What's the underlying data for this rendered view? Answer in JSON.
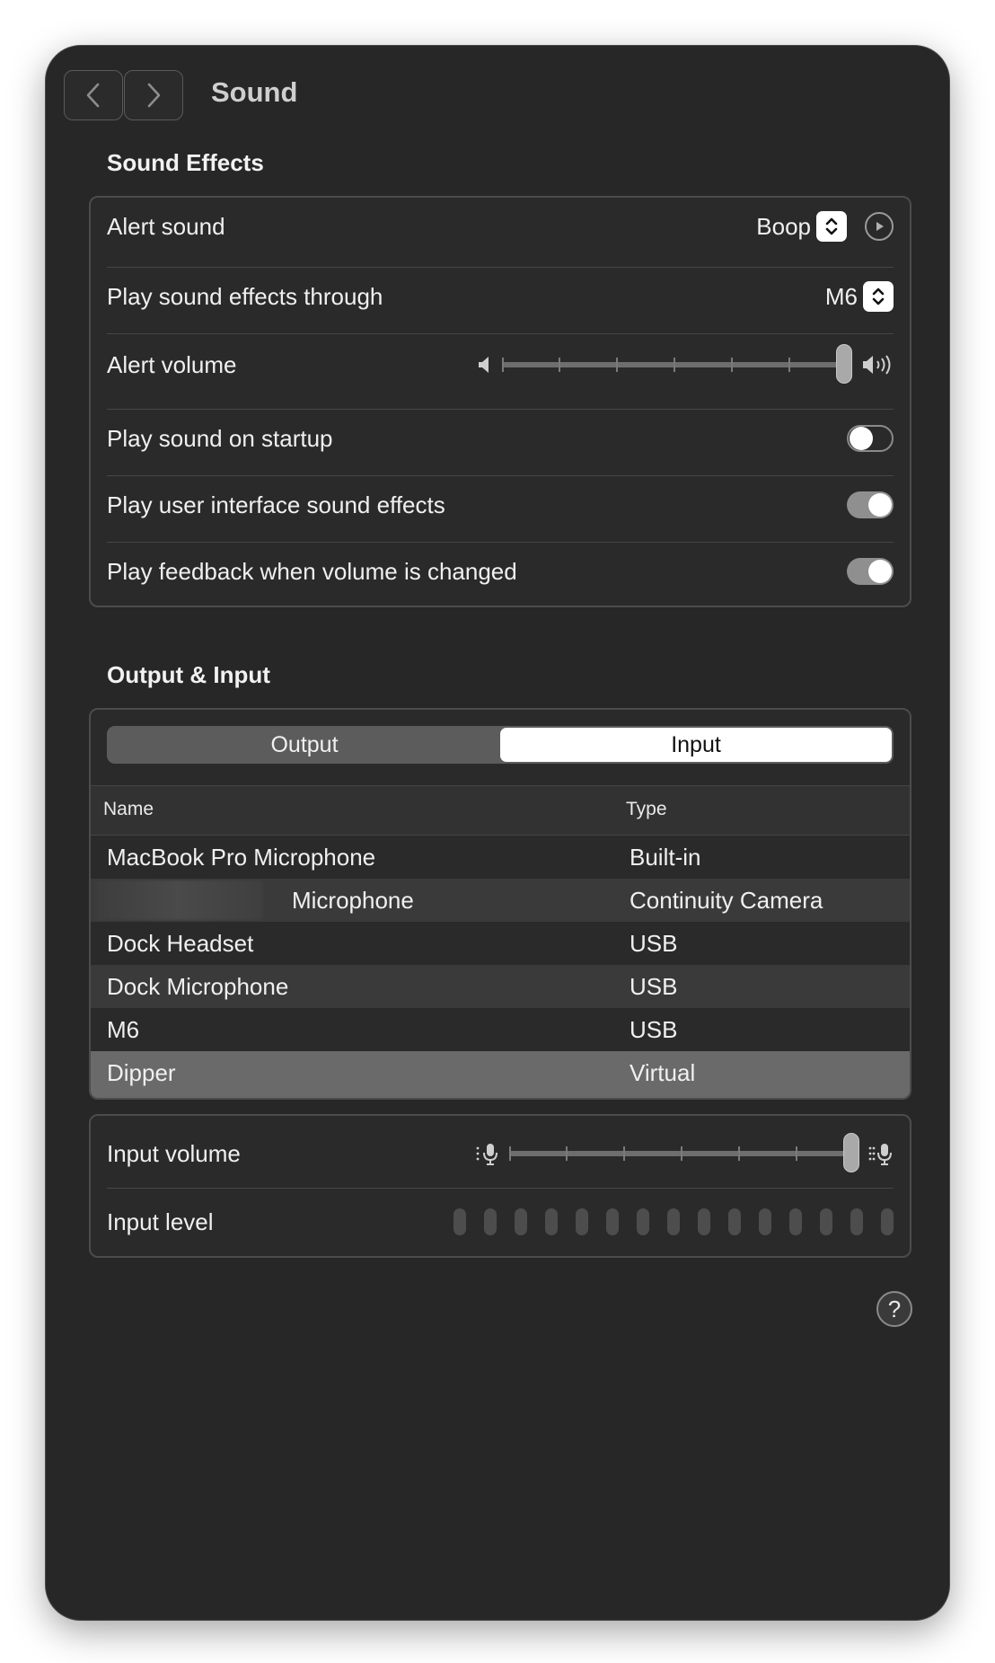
{
  "window": {
    "title": "Sound"
  },
  "nav": {
    "back_icon": "chevron-left-icon",
    "forward_icon": "chevron-right-icon"
  },
  "sound_effects": {
    "title": "Sound Effects",
    "alert_sound": {
      "label": "Alert sound",
      "value": "Boop"
    },
    "play_through": {
      "label": "Play sound effects through",
      "value": "M6"
    },
    "alert_volume": {
      "label": "Alert volume",
      "level": 1.0
    },
    "startup": {
      "label": "Play sound on startup",
      "on": false
    },
    "ui_effects": {
      "label": "Play user interface sound effects",
      "on": true
    },
    "feedback": {
      "label": "Play feedback when volume is changed",
      "on": true
    }
  },
  "output_input": {
    "title": "Output & Input",
    "tabs": [
      {
        "label": "Output",
        "active": false
      },
      {
        "label": "Input",
        "active": true
      }
    ],
    "columns": {
      "name": "Name",
      "type": "Type"
    },
    "rows": [
      {
        "name": "MacBook Pro Microphone",
        "type": "Built-in",
        "selected": false
      },
      {
        "name": "Microphone",
        "type": "Continuity Camera",
        "selected": false,
        "redacted_prefix": true
      },
      {
        "name": "Dock Headset",
        "type": "USB",
        "selected": false
      },
      {
        "name": "Dock Microphone",
        "type": "USB",
        "selected": false
      },
      {
        "name": "M6",
        "type": "USB",
        "selected": false
      },
      {
        "name": "Dipper",
        "type": "Virtual",
        "selected": true
      }
    ]
  },
  "input": {
    "volume": {
      "label": "Input volume",
      "level": 1.0
    },
    "level": {
      "label": "Input level",
      "bars": 15,
      "lit": 0
    }
  },
  "help": {
    "label": "?"
  },
  "colors": {
    "selected_row": "#6a6a6a",
    "stripe_row": "#3a3a3a",
    "toggle_on": "#8f8f8f"
  }
}
